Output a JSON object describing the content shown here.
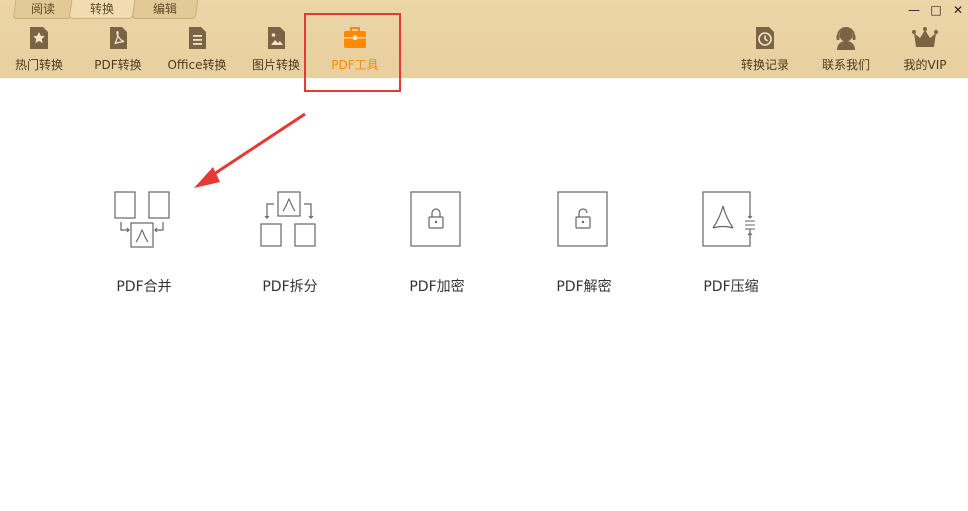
{
  "tabs": [
    {
      "label": "阅读",
      "active": false
    },
    {
      "label": "转换",
      "active": true
    },
    {
      "label": "编辑",
      "active": false
    }
  ],
  "window_controls": {
    "minimize": "—",
    "maximize": "□",
    "close": "✕"
  },
  "toolbar_left": [
    {
      "label": "热门转换",
      "icon": "star-file-icon"
    },
    {
      "label": "PDF转换",
      "icon": "pdf-file-icon"
    },
    {
      "label": "Office转换",
      "icon": "doc-file-icon"
    },
    {
      "label": "图片转换",
      "icon": "image-file-icon"
    },
    {
      "label": "PDF工具",
      "icon": "toolbox-icon",
      "active": true
    }
  ],
  "toolbar_right": [
    {
      "label": "转换记录",
      "icon": "history-clock-icon"
    },
    {
      "label": "联系我们",
      "icon": "headset-icon"
    },
    {
      "label": "我的VIP",
      "icon": "crown-icon"
    }
  ],
  "tools": [
    {
      "label": "PDF合并",
      "icon": "pdf-merge-icon"
    },
    {
      "label": "PDF拆分",
      "icon": "pdf-split-icon"
    },
    {
      "label": "PDF加密",
      "icon": "pdf-lock-icon"
    },
    {
      "label": "PDF解密",
      "icon": "pdf-unlock-icon"
    },
    {
      "label": "PDF压缩",
      "icon": "pdf-compress-icon"
    }
  ],
  "colors": {
    "toolbar_bg": "#e8cf9f",
    "active_accent": "#ff8a00",
    "highlight_box": "#e53935",
    "icon_brown": "#7a6445"
  }
}
